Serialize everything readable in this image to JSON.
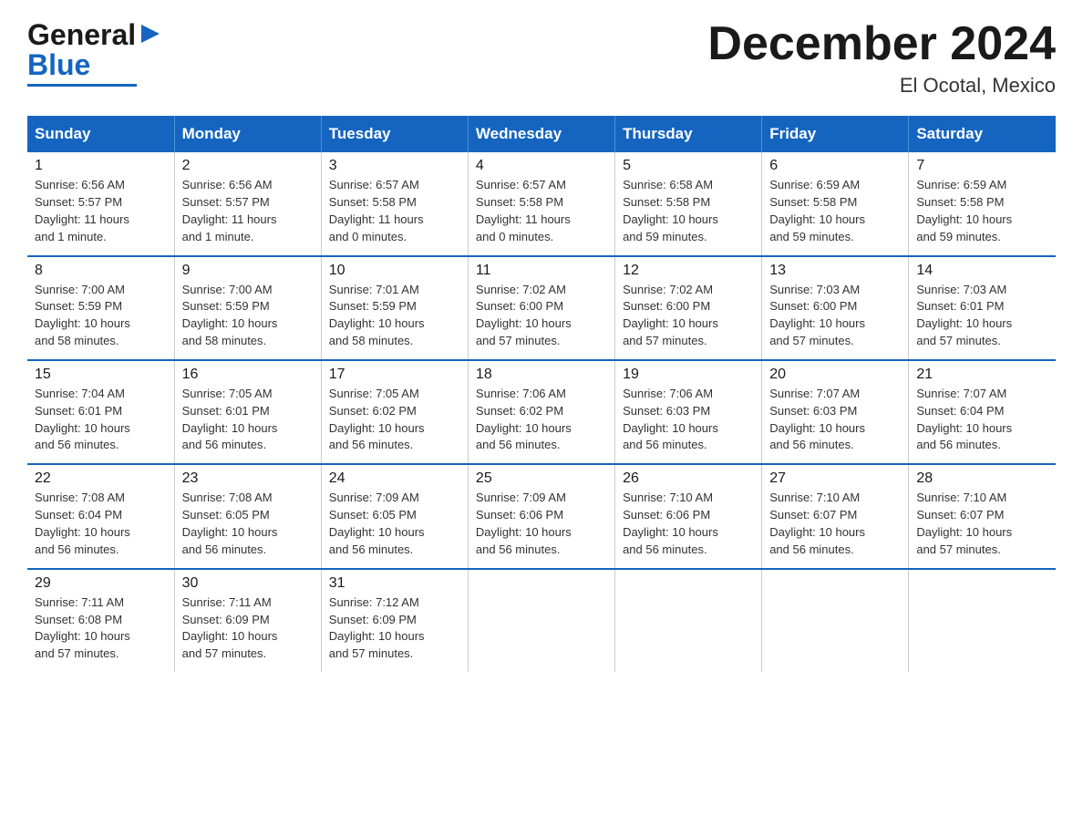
{
  "header": {
    "logo_general": "General",
    "logo_blue": "Blue",
    "month_title": "December 2024",
    "location": "El Ocotal, Mexico"
  },
  "days_of_week": [
    "Sunday",
    "Monday",
    "Tuesday",
    "Wednesday",
    "Thursday",
    "Friday",
    "Saturday"
  ],
  "weeks": [
    [
      {
        "day": "1",
        "info": "Sunrise: 6:56 AM\nSunset: 5:57 PM\nDaylight: 11 hours\nand 1 minute."
      },
      {
        "day": "2",
        "info": "Sunrise: 6:56 AM\nSunset: 5:57 PM\nDaylight: 11 hours\nand 1 minute."
      },
      {
        "day": "3",
        "info": "Sunrise: 6:57 AM\nSunset: 5:58 PM\nDaylight: 11 hours\nand 0 minutes."
      },
      {
        "day": "4",
        "info": "Sunrise: 6:57 AM\nSunset: 5:58 PM\nDaylight: 11 hours\nand 0 minutes."
      },
      {
        "day": "5",
        "info": "Sunrise: 6:58 AM\nSunset: 5:58 PM\nDaylight: 10 hours\nand 59 minutes."
      },
      {
        "day": "6",
        "info": "Sunrise: 6:59 AM\nSunset: 5:58 PM\nDaylight: 10 hours\nand 59 minutes."
      },
      {
        "day": "7",
        "info": "Sunrise: 6:59 AM\nSunset: 5:58 PM\nDaylight: 10 hours\nand 59 minutes."
      }
    ],
    [
      {
        "day": "8",
        "info": "Sunrise: 7:00 AM\nSunset: 5:59 PM\nDaylight: 10 hours\nand 58 minutes."
      },
      {
        "day": "9",
        "info": "Sunrise: 7:00 AM\nSunset: 5:59 PM\nDaylight: 10 hours\nand 58 minutes."
      },
      {
        "day": "10",
        "info": "Sunrise: 7:01 AM\nSunset: 5:59 PM\nDaylight: 10 hours\nand 58 minutes."
      },
      {
        "day": "11",
        "info": "Sunrise: 7:02 AM\nSunset: 6:00 PM\nDaylight: 10 hours\nand 57 minutes."
      },
      {
        "day": "12",
        "info": "Sunrise: 7:02 AM\nSunset: 6:00 PM\nDaylight: 10 hours\nand 57 minutes."
      },
      {
        "day": "13",
        "info": "Sunrise: 7:03 AM\nSunset: 6:00 PM\nDaylight: 10 hours\nand 57 minutes."
      },
      {
        "day": "14",
        "info": "Sunrise: 7:03 AM\nSunset: 6:01 PM\nDaylight: 10 hours\nand 57 minutes."
      }
    ],
    [
      {
        "day": "15",
        "info": "Sunrise: 7:04 AM\nSunset: 6:01 PM\nDaylight: 10 hours\nand 56 minutes."
      },
      {
        "day": "16",
        "info": "Sunrise: 7:05 AM\nSunset: 6:01 PM\nDaylight: 10 hours\nand 56 minutes."
      },
      {
        "day": "17",
        "info": "Sunrise: 7:05 AM\nSunset: 6:02 PM\nDaylight: 10 hours\nand 56 minutes."
      },
      {
        "day": "18",
        "info": "Sunrise: 7:06 AM\nSunset: 6:02 PM\nDaylight: 10 hours\nand 56 minutes."
      },
      {
        "day": "19",
        "info": "Sunrise: 7:06 AM\nSunset: 6:03 PM\nDaylight: 10 hours\nand 56 minutes."
      },
      {
        "day": "20",
        "info": "Sunrise: 7:07 AM\nSunset: 6:03 PM\nDaylight: 10 hours\nand 56 minutes."
      },
      {
        "day": "21",
        "info": "Sunrise: 7:07 AM\nSunset: 6:04 PM\nDaylight: 10 hours\nand 56 minutes."
      }
    ],
    [
      {
        "day": "22",
        "info": "Sunrise: 7:08 AM\nSunset: 6:04 PM\nDaylight: 10 hours\nand 56 minutes."
      },
      {
        "day": "23",
        "info": "Sunrise: 7:08 AM\nSunset: 6:05 PM\nDaylight: 10 hours\nand 56 minutes."
      },
      {
        "day": "24",
        "info": "Sunrise: 7:09 AM\nSunset: 6:05 PM\nDaylight: 10 hours\nand 56 minutes."
      },
      {
        "day": "25",
        "info": "Sunrise: 7:09 AM\nSunset: 6:06 PM\nDaylight: 10 hours\nand 56 minutes."
      },
      {
        "day": "26",
        "info": "Sunrise: 7:10 AM\nSunset: 6:06 PM\nDaylight: 10 hours\nand 56 minutes."
      },
      {
        "day": "27",
        "info": "Sunrise: 7:10 AM\nSunset: 6:07 PM\nDaylight: 10 hours\nand 56 minutes."
      },
      {
        "day": "28",
        "info": "Sunrise: 7:10 AM\nSunset: 6:07 PM\nDaylight: 10 hours\nand 57 minutes."
      }
    ],
    [
      {
        "day": "29",
        "info": "Sunrise: 7:11 AM\nSunset: 6:08 PM\nDaylight: 10 hours\nand 57 minutes."
      },
      {
        "day": "30",
        "info": "Sunrise: 7:11 AM\nSunset: 6:09 PM\nDaylight: 10 hours\nand 57 minutes."
      },
      {
        "day": "31",
        "info": "Sunrise: 7:12 AM\nSunset: 6:09 PM\nDaylight: 10 hours\nand 57 minutes."
      },
      {
        "day": "",
        "info": ""
      },
      {
        "day": "",
        "info": ""
      },
      {
        "day": "",
        "info": ""
      },
      {
        "day": "",
        "info": ""
      }
    ]
  ]
}
